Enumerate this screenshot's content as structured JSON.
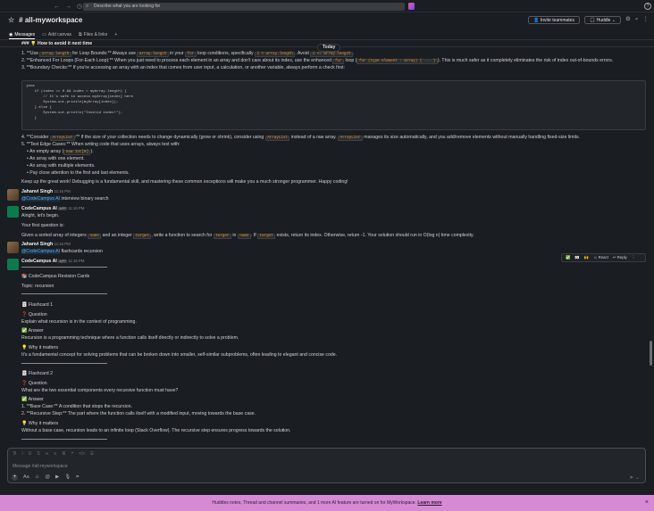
{
  "topbar": {
    "search_placeholder": "Describe what you are looking for"
  },
  "header": {
    "channel": "# all-myworkspace",
    "invite": "Invite teammates",
    "huddle": "Huddle"
  },
  "tabs": [
    "Messages",
    "Add canvas",
    "Files & links"
  ],
  "today": "Today",
  "msg1": {
    "heading": "### 💡 How to avoid it next time",
    "l1a": "1. **Use ",
    "l1b": "array.length",
    "l1c": " for Loop Bounds:** Always use ",
    "l1d": "array.length",
    "l1e": " in your ",
    "l1f": "for",
    "l1g": " loop conditions, specifically ",
    "l1h": "i < array.length",
    "l1i": ". Avoid ",
    "l1j": "i <= array.length",
    "l1k": ".",
    "l2a": "2. **Enhanced For Loops (For-Each Loop):** When you just need to process each element in an array and don't care about its index, use the enhanced ",
    "l2b": "for",
    "l2c": " loop (",
    "l2d": "for (type element : array) { ... }",
    "l2e": "). This is much safer as it completely eliminates the risk of index out-of-bounds errors.",
    "l3": "3. **Boundary Checks:** If you're accessing an array with an index that comes from user input, a calculation, or another variable, always perform a check first:",
    "code": "java\n    if (index >= 0 && index < myArray.length) {\n        // It's safe to access myArray[index] here\n        System.out.println(myArray[index]);\n    } else {\n        System.out.println(\"Invalid index!\");\n    }",
    "l4a": "4. **Consider ",
    "l4b": "ArrayList",
    "l4c": ":** If the size of your collection needs to change dynamically (grow or shrink), consider using ",
    "l4d": "ArrayList",
    "l4e": " instead of a raw array. ",
    "l4f": "ArrayList",
    "l4g": " manages its size automatically, and you add/remove elements without manually handling fixed-size limits.",
    "l5": "5. **Test Edge Cases:** When writing code that uses arrays, always test with:",
    "b1a": "An empty array (",
    "b1b": "new int[0]",
    "b1c": ").",
    "b2": "An array with one element.",
    "b3": "An array with multiple elements.",
    "b4": "Pay close attention to the first and last elements.",
    "closing": "Keep up the great work! Debugging is a fundamental skill, and mastering these common exceptions will make you a much stronger programmer. Happy coding!"
  },
  "msg2": {
    "name": "Jahanvi Singh",
    "time": "11:16 PM",
    "mention": "@CodeCampus AI",
    "text": "interview binary search"
  },
  "msg3": {
    "name": "CodeCampus AI",
    "app": "APP",
    "time": "11:16 PM",
    "t1": "Alright, let's begin.",
    "t2": "Your first question is:",
    "q_a": "Given a sorted array of integers ",
    "q_b": "nums",
    "q_c": " and an integer ",
    "q_d": "target",
    "q_e": ", write a function to search for ",
    "q_f": "target",
    "q_g": " in ",
    "q_h": "nums",
    "q_i": ". If ",
    "q_j": "target",
    "q_k": " exists, return its index. Otherwise, return -1. Your solution should run in O(log n) time complexity."
  },
  "msg4": {
    "name": "Jahanvi Singh",
    "time": "11:16 PM",
    "mention": "@CodeCampus AI",
    "text": "flashcards recursion"
  },
  "msg5": {
    "name": "CodeCampus AI",
    "app": "APP",
    "time": "11:16 PM",
    "title": "📚 CodeCampus Revision Cards",
    "topic": "Topic: recursion",
    "f1": "🃏 Flashcard 1",
    "q": "❓ Question",
    "a": "✅ Answer",
    "w": "💡 Why it matters",
    "f1q": "Explain what recursion is in the context of programming.",
    "f1a": "Recursion is a programming technique where a function calls itself directly or indirectly to solve a problem.",
    "f1w": "It's a fundamental concept for solving problems that can be broken down into smaller, self-similar subproblems, often leading to elegant and concise code.",
    "f2": "🃏 Flashcard 2",
    "f2q": "What are the two essential components every recursive function must have?",
    "f2a1": "1. **Base Case:** A condition that stops the recursion.",
    "f2a2": "2. **Recursive Step:** The part where the function calls itself with a modified input, moving towards the base case.",
    "f2w": "Without a base case, recursion leads to an infinite loop (Stack Overflow). The recursive step ensures progress towards the solution."
  },
  "hover": {
    "e1": "✅",
    "e2": "👀",
    "e3": "🙌",
    "react": "React",
    "reply": "Reply"
  },
  "composer": {
    "placeholder": "Message #all-myworkspace"
  },
  "banner": {
    "text": "Huddles notes, Thread and channel summaries, and 1 more AI feature are turned on for MyWorkspace.",
    "link": "Learn more"
  }
}
